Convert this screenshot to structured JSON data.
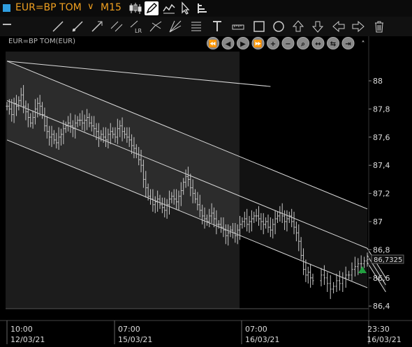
{
  "window": {
    "symbol": "EUR=BP TOM",
    "timeframe": "M15",
    "accent_color": "#f0a020",
    "symbol_color": "#2f9ee0"
  },
  "title_icons": [
    "candlestick-chart-icon",
    "edit-pencil-icon",
    "chart-style-icon",
    "cursor-icon",
    "bar-chart-icon"
  ],
  "drawing_tools": [
    "line-tool-icon",
    "ray-tool-icon",
    "arrow-line-tool-icon",
    "parallel-lines-tool-icon",
    "regression-channel-tool-icon",
    "andrews-pitchfork-icon",
    "fan-lines-icon",
    "fibonacci-levels-icon",
    "text-tool-icon",
    "ruler-tool-icon",
    "rectangle-tool-icon",
    "ellipse-tool-icon",
    "arrow-up-tool-icon",
    "arrow-down-tool-icon",
    "arrow-left-tool-icon",
    "arrow-right-tool-icon",
    "trash-icon"
  ],
  "nav_buttons": [
    "first-page-icon",
    "previous-icon",
    "next-icon",
    "last-page-icon",
    "zoom-in-icon",
    "zoom-out-icon",
    "zoom-fit-icon",
    "expand-horizontal-icon",
    "compress-horizontal-icon",
    "go-to-end-icon",
    "collapse-panel-icon"
  ],
  "chart_data": {
    "type": "bar",
    "subtype": "ohlc",
    "legend": "EUR=BP TOM(EUR)",
    "ylim": [
      86.4,
      88.1
    ],
    "y_ticks": [
      "88",
      "87,8",
      "87,6",
      "87,4",
      "87,2",
      "87",
      "86,8",
      "86,6",
      "86,4"
    ],
    "x_ticks": [
      {
        "time": "10:00",
        "date": "12/03/21"
      },
      {
        "time": "07:00",
        "date": "15/03/21"
      },
      {
        "time": "07:00",
        "date": "16/03/21"
      },
      {
        "time": "23:30",
        "date": "16/03/21"
      }
    ],
    "last_price": "86,7325",
    "close_series": [
      87.82,
      87.8,
      87.76,
      87.84,
      87.82,
      87.86,
      87.9,
      87.82,
      87.78,
      87.74,
      87.7,
      87.74,
      87.8,
      87.84,
      87.82,
      87.76,
      87.68,
      87.64,
      87.6,
      87.62,
      87.58,
      87.56,
      87.6,
      87.62,
      87.66,
      87.68,
      87.7,
      87.68,
      87.66,
      87.7,
      87.72,
      87.72,
      87.7,
      87.72,
      87.74,
      87.7,
      87.68,
      87.66,
      87.64,
      87.6,
      87.62,
      87.6,
      87.58,
      87.62,
      87.64,
      87.62,
      87.6,
      87.66,
      87.68,
      87.64,
      87.62,
      87.6,
      87.58,
      87.54,
      87.52,
      87.48,
      87.44,
      87.4,
      87.3,
      87.24,
      87.18,
      87.16,
      87.12,
      87.14,
      87.16,
      87.12,
      87.1,
      87.08,
      87.12,
      87.16,
      87.18,
      87.16,
      87.14,
      87.18,
      87.22,
      87.28,
      87.32,
      87.3,
      87.24,
      87.2,
      87.16,
      87.12,
      87.08,
      87.04,
      87.02,
      87.0,
      87.04,
      87.06,
      87.02,
      86.98,
      86.98,
      86.96,
      86.94,
      86.9,
      86.92,
      86.94,
      86.92,
      86.9,
      86.94,
      86.98,
      87.0,
      87.02,
      86.98,
      87.0,
      87.02,
      87.04,
      87.04,
      87.02,
      87.0,
      86.98,
      87.0,
      86.96,
      86.94,
      86.98,
      87.02,
      87.04,
      87.06,
      87.04,
      87.0,
      87.02,
      87.04,
      87.0,
      86.96,
      86.92,
      86.86,
      86.76,
      86.66,
      86.62,
      86.64,
      86.6,
      86.58,
      86.62,
      86.6,
      86.56,
      86.52,
      86.54,
      86.58,
      86.56,
      86.6,
      86.62,
      86.62,
      86.66,
      86.68,
      86.7,
      86.7,
      86.72,
      86.73
    ],
    "gap_after_index": 130,
    "channels": [
      {
        "type": "regression-channel",
        "from": [
          0,
          88.14
        ],
        "to": [
          112,
          87.96
        ],
        "color": "#dddddd"
      },
      {
        "type": "regression-channel",
        "from": [
          0,
          87.86
        ],
        "to": [
          150,
          86.81
        ],
        "upper_offset": 0.28,
        "lower_offset": -0.28,
        "color": "#dddddd"
      },
      {
        "type": "regression-channel",
        "from": [
          152,
          86.55
        ],
        "to": [
          170,
          86.76
        ],
        "upper_offset": 0.05,
        "lower_offset": -0.05,
        "color": "#dddddd"
      }
    ],
    "colors": {
      "background": "#000000",
      "plot_highlight": "#1c1c1c",
      "bars": "#c8c8c8",
      "channel_fill": "#ffffff",
      "last_price_marker": "#22a040"
    }
  }
}
